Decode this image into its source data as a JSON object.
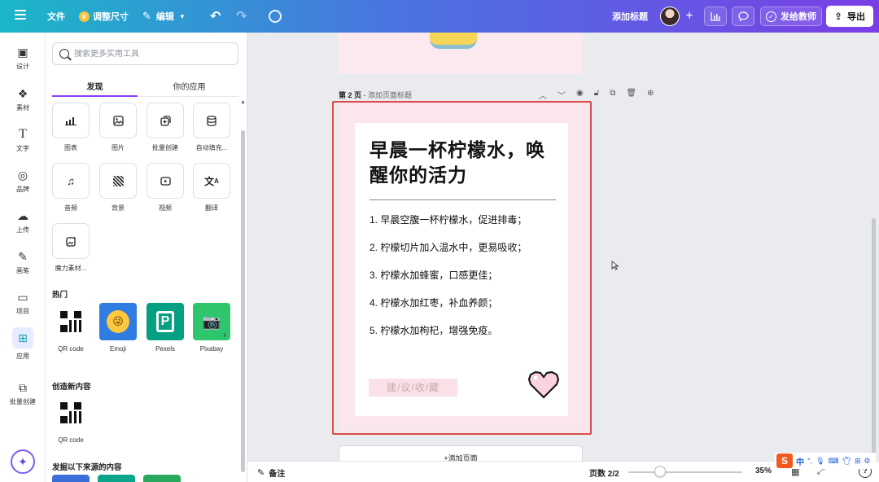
{
  "topbar": {
    "file": "文件",
    "resize": "调整尺寸",
    "edit": "编辑",
    "add_title": "添加标题",
    "send_teacher": "发给教师",
    "export": "导出"
  },
  "rail": {
    "items": [
      {
        "label": "设计"
      },
      {
        "label": "素材"
      },
      {
        "label": "文字"
      },
      {
        "label": "品牌"
      },
      {
        "label": "上传"
      },
      {
        "label": "画笔"
      },
      {
        "label": "项目"
      },
      {
        "label": "应用"
      },
      {
        "label": "批量创建"
      }
    ]
  },
  "panel": {
    "search_placeholder": "搜索更多实用工具",
    "tabs": [
      "发现",
      "你的应用"
    ],
    "tools": [
      {
        "label": "图表",
        "icon": "chart-icon"
      },
      {
        "label": "图片",
        "icon": "image-icon"
      },
      {
        "label": "批量创建",
        "icon": "bulk-create-icon"
      },
      {
        "label": "自动填充...",
        "icon": "database-icon"
      },
      {
        "label": "音频",
        "icon": "music-icon"
      },
      {
        "label": "背景",
        "icon": "background-icon"
      },
      {
        "label": "视频",
        "icon": "video-icon"
      },
      {
        "label": "翻译",
        "icon": "translate-icon"
      },
      {
        "label": "魔力素材...",
        "icon": "magic-media-icon"
      }
    ],
    "hot_title": "热门",
    "hot_apps": [
      {
        "label": "QR code"
      },
      {
        "label": "Emoji"
      },
      {
        "label": "Pexels"
      },
      {
        "label": "Pixabay"
      }
    ],
    "create_title": "创造新内容",
    "create_apps": [
      {
        "label": "QR code"
      }
    ],
    "discover_title": "发掘以下来源的内容"
  },
  "canvas": {
    "page_label": "第 2 页",
    "page_title_placeholder": "添加页面标题",
    "card_title": "早晨一杯柠檬水，唤醒你的活力",
    "list": [
      "1. 早晨空腹一杯柠檬水，促进排毒；",
      "2. 柠檬切片加入温水中，更易吸收；",
      "3. 柠檬水加蜂蜜，口感更佳；",
      "4. 柠檬水加红枣，补血养颜；",
      "5. 柠檬水加枸杞，增强免疫。"
    ],
    "stamp": "建/议/收/藏",
    "add_page": "+添加页面"
  },
  "bottombar": {
    "notes": "备注",
    "pages": "页数 2/2",
    "zoom": "35%",
    "zoom_fraction": 0.35,
    "help": "?"
  },
  "ime": {
    "cn": "中"
  },
  "colors": {
    "accent": "#8b3dff",
    "selection": "#e04949",
    "page_bg": "#fce6ee"
  }
}
